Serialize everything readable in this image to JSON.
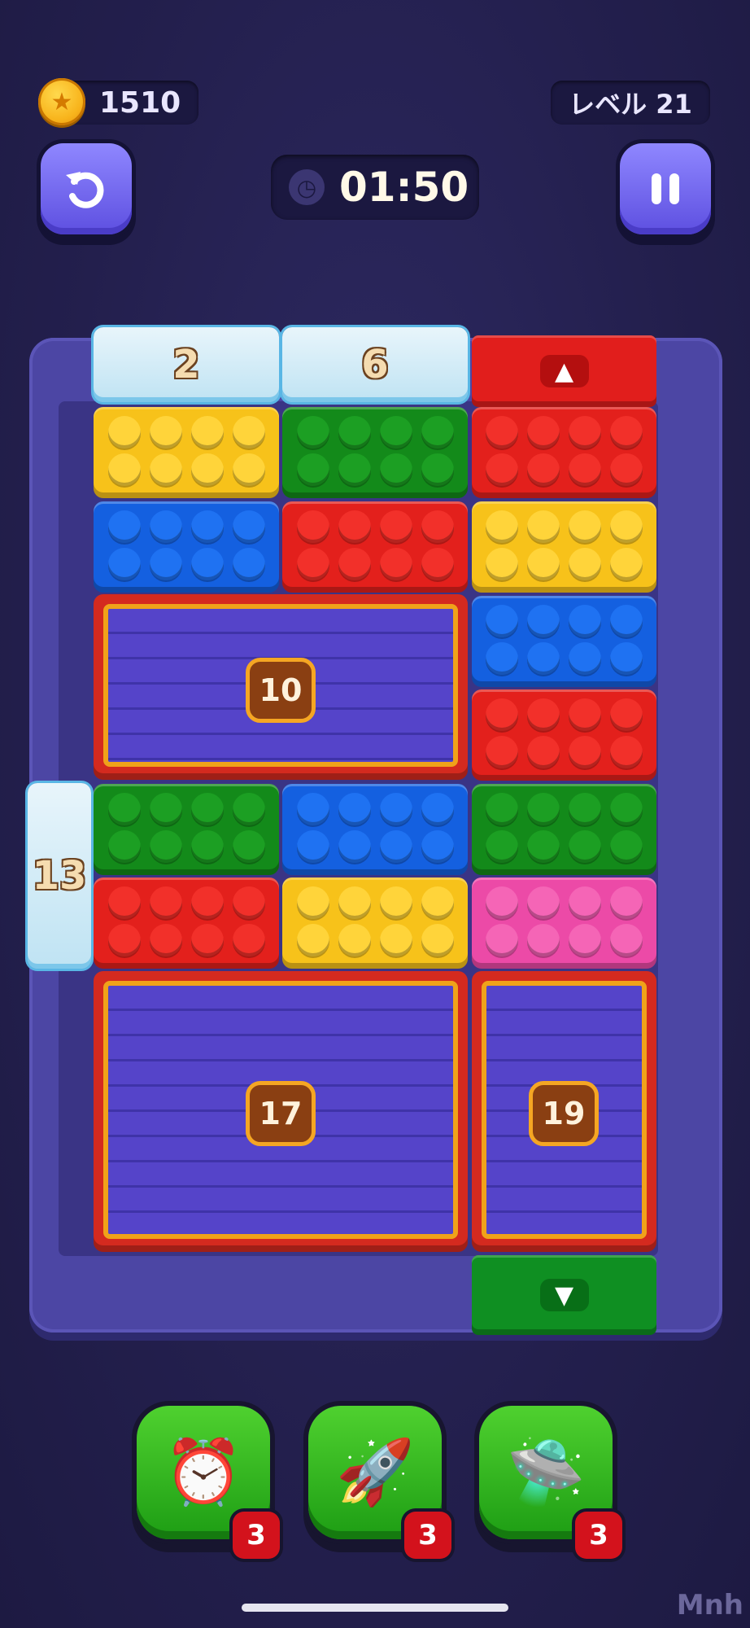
{
  "hud": {
    "coins": "1510",
    "level": "レベル 21",
    "timer": "01:50",
    "undo_icon": "undo-arrow-icon",
    "pause_icon": "pause-icon",
    "clock_icon": "clock-icon",
    "coin_icon": "star-coin-icon"
  },
  "board": {
    "ice_top_left": "2",
    "ice_top_mid": "6",
    "ice_left_side": "13",
    "crate_a": "10",
    "crate_b": "17",
    "crate_c": "19",
    "exit_top_color": "red",
    "exit_bottom_color": "green"
  },
  "boosters": [
    {
      "name": "alarm-clock",
      "icon": "⏰",
      "count": "3"
    },
    {
      "name": "rocket",
      "icon": "🚀",
      "count": "3"
    },
    {
      "name": "ufo",
      "icon": "🛸",
      "count": "3"
    }
  ],
  "watermark": "Mnh"
}
